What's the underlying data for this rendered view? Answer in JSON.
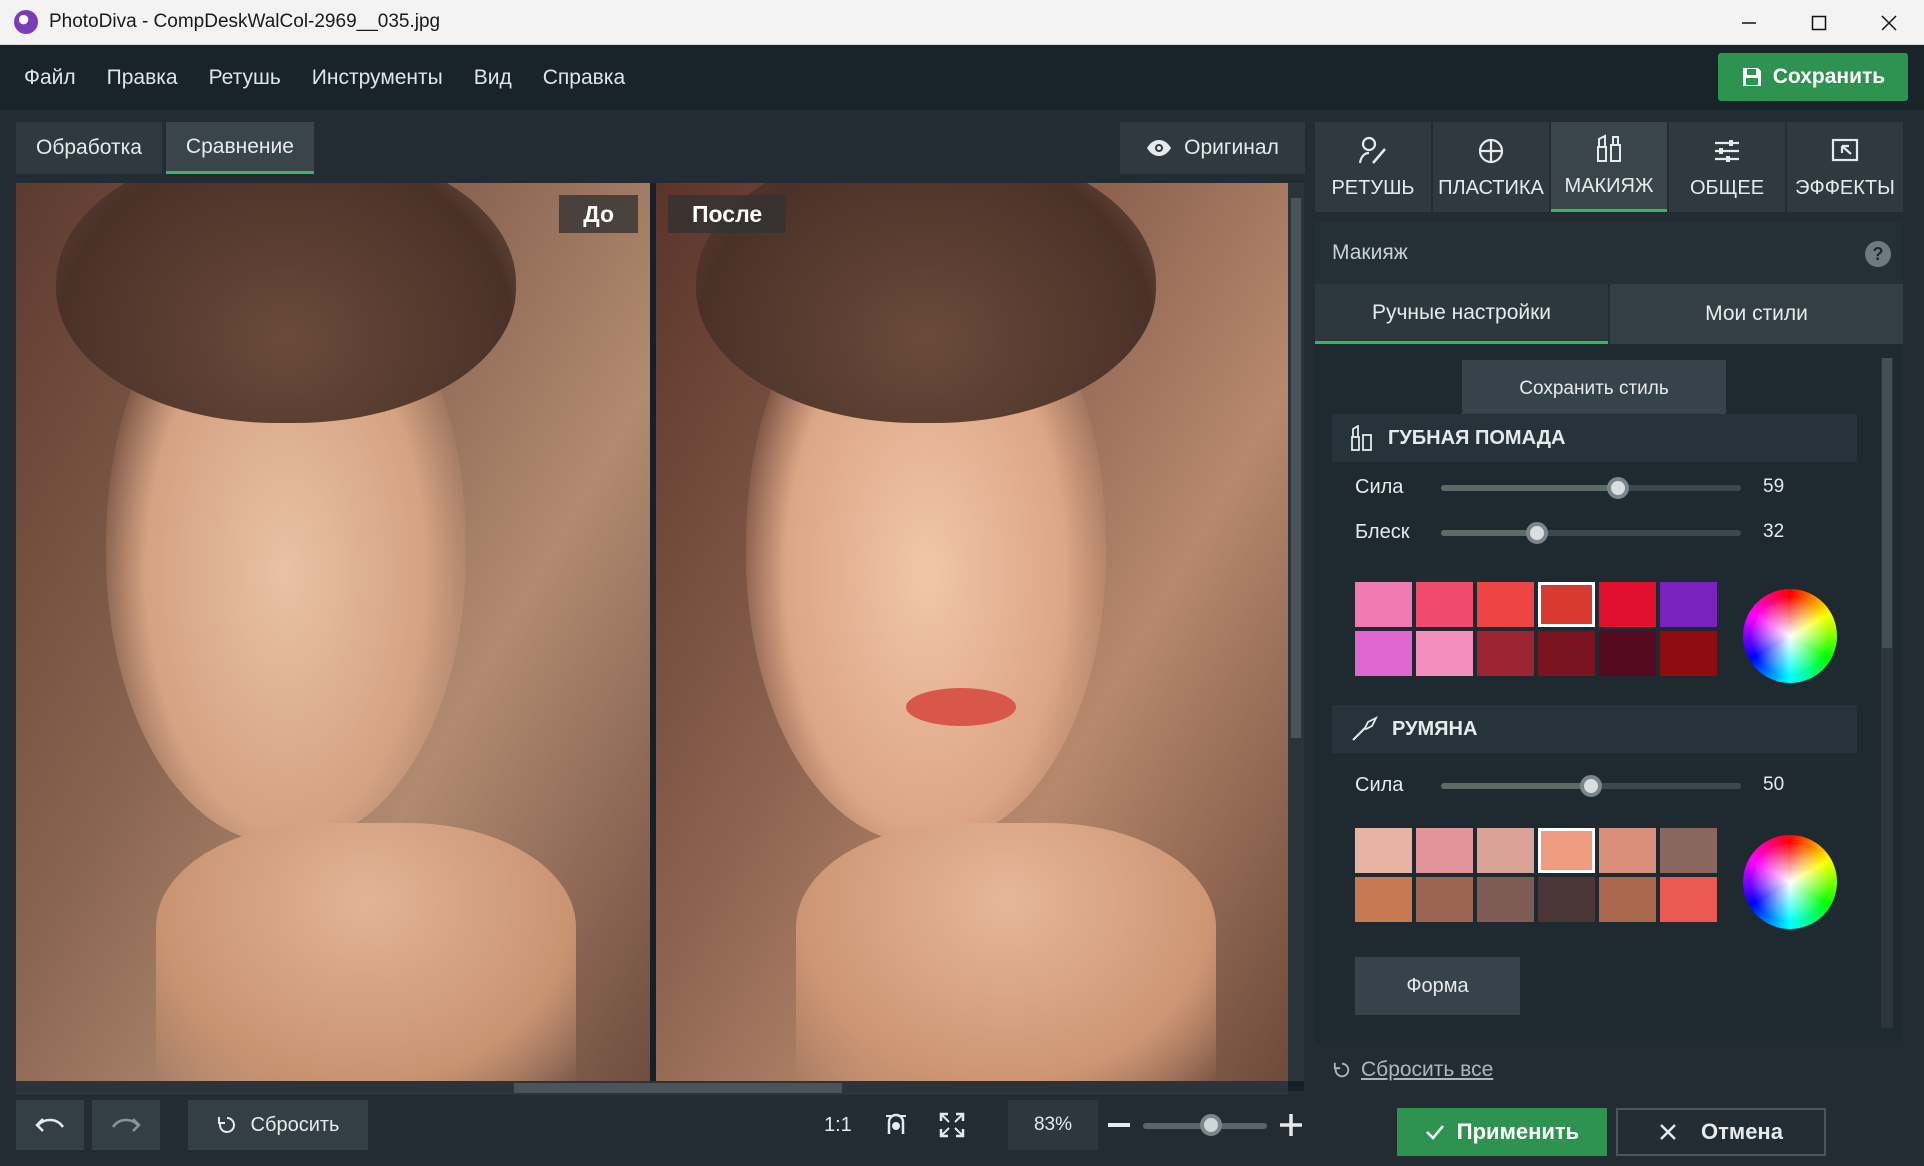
{
  "window": {
    "title": "PhotoDiva - CompDeskWalCol-2969__035.jpg"
  },
  "menu": [
    "Файл",
    "Правка",
    "Ретушь",
    "Инструменты",
    "Вид",
    "Справка"
  ],
  "header": {
    "save_label": "Сохранить"
  },
  "view_tabs": [
    "Обработка",
    "Сравнение"
  ],
  "original_label": "Оригинал",
  "compare": {
    "before_label": "До",
    "after_label": "После"
  },
  "bottom": {
    "reset_label": "Сбросить",
    "one_to_one": "1:1",
    "zoom_text": "83%",
    "zoom_level": 0.55
  },
  "tools": [
    {
      "label": "РЕТУШЬ",
      "icon": "retouch-icon"
    },
    {
      "label": "ПЛАСТИКА",
      "icon": "plastic-icon"
    },
    {
      "label": "МАКИЯЖ",
      "icon": "makeup-icon"
    },
    {
      "label": "ОБЩЕЕ",
      "icon": "general-icon"
    },
    {
      "label": "ЭФФЕКТЫ",
      "icon": "effects-icon"
    }
  ],
  "panel": {
    "title": "Макияж",
    "help": "?",
    "subtabs": [
      "Ручные настройки",
      "Мои стили"
    ],
    "save_style_label": "Сохранить стиль",
    "lipstick": {
      "title": "ГУБНАЯ ПОМАДА",
      "strength_label": "Сила",
      "strength_value": "59",
      "strength": 59,
      "gloss_label": "Блеск",
      "gloss_value": "32",
      "gloss": 32,
      "colors": [
        "#f07ab1",
        "#ee4b6e",
        "#ef4444",
        "#d93a30",
        "#e0102e",
        "#7a22c0",
        "#e067d0",
        "#f48fbd",
        "#9b2532",
        "#7a1220",
        "#560a22",
        "#8e0b0f"
      ],
      "selected": 3
    },
    "blush": {
      "title": "РУМЯНА",
      "strength_label": "Сила",
      "strength_value": "50",
      "strength": 50,
      "colors": [
        "#e7b3a3",
        "#e2949a",
        "#d9a397",
        "#ee9b80",
        "#d98e7c",
        "#8a6660",
        "#c77a52",
        "#9c6552",
        "#7e5b55",
        "#4b3637",
        "#a9674b",
        "#ea5a52"
      ],
      "selected": 3,
      "shape_label": "Форма"
    },
    "reset_all_label": "Сбросить все"
  },
  "footer": {
    "apply_label": "Применить",
    "cancel_label": "Отмена"
  },
  "accent_color": "#2e9350"
}
